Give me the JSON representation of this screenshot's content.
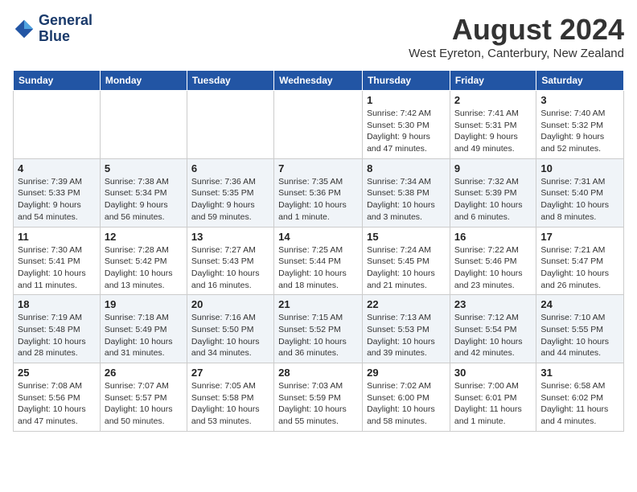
{
  "header": {
    "logo_line1": "General",
    "logo_line2": "Blue",
    "month_year": "August 2024",
    "location": "West Eyreton, Canterbury, New Zealand"
  },
  "days_of_week": [
    "Sunday",
    "Monday",
    "Tuesday",
    "Wednesday",
    "Thursday",
    "Friday",
    "Saturday"
  ],
  "weeks": [
    [
      {
        "day": "",
        "info": ""
      },
      {
        "day": "",
        "info": ""
      },
      {
        "day": "",
        "info": ""
      },
      {
        "day": "",
        "info": ""
      },
      {
        "day": "1",
        "info": "Sunrise: 7:42 AM\nSunset: 5:30 PM\nDaylight: 9 hours\nand 47 minutes."
      },
      {
        "day": "2",
        "info": "Sunrise: 7:41 AM\nSunset: 5:31 PM\nDaylight: 9 hours\nand 49 minutes."
      },
      {
        "day": "3",
        "info": "Sunrise: 7:40 AM\nSunset: 5:32 PM\nDaylight: 9 hours\nand 52 minutes."
      }
    ],
    [
      {
        "day": "4",
        "info": "Sunrise: 7:39 AM\nSunset: 5:33 PM\nDaylight: 9 hours\nand 54 minutes."
      },
      {
        "day": "5",
        "info": "Sunrise: 7:38 AM\nSunset: 5:34 PM\nDaylight: 9 hours\nand 56 minutes."
      },
      {
        "day": "6",
        "info": "Sunrise: 7:36 AM\nSunset: 5:35 PM\nDaylight: 9 hours\nand 59 minutes."
      },
      {
        "day": "7",
        "info": "Sunrise: 7:35 AM\nSunset: 5:36 PM\nDaylight: 10 hours\nand 1 minute."
      },
      {
        "day": "8",
        "info": "Sunrise: 7:34 AM\nSunset: 5:38 PM\nDaylight: 10 hours\nand 3 minutes."
      },
      {
        "day": "9",
        "info": "Sunrise: 7:32 AM\nSunset: 5:39 PM\nDaylight: 10 hours\nand 6 minutes."
      },
      {
        "day": "10",
        "info": "Sunrise: 7:31 AM\nSunset: 5:40 PM\nDaylight: 10 hours\nand 8 minutes."
      }
    ],
    [
      {
        "day": "11",
        "info": "Sunrise: 7:30 AM\nSunset: 5:41 PM\nDaylight: 10 hours\nand 11 minutes."
      },
      {
        "day": "12",
        "info": "Sunrise: 7:28 AM\nSunset: 5:42 PM\nDaylight: 10 hours\nand 13 minutes."
      },
      {
        "day": "13",
        "info": "Sunrise: 7:27 AM\nSunset: 5:43 PM\nDaylight: 10 hours\nand 16 minutes."
      },
      {
        "day": "14",
        "info": "Sunrise: 7:25 AM\nSunset: 5:44 PM\nDaylight: 10 hours\nand 18 minutes."
      },
      {
        "day": "15",
        "info": "Sunrise: 7:24 AM\nSunset: 5:45 PM\nDaylight: 10 hours\nand 21 minutes."
      },
      {
        "day": "16",
        "info": "Sunrise: 7:22 AM\nSunset: 5:46 PM\nDaylight: 10 hours\nand 23 minutes."
      },
      {
        "day": "17",
        "info": "Sunrise: 7:21 AM\nSunset: 5:47 PM\nDaylight: 10 hours\nand 26 minutes."
      }
    ],
    [
      {
        "day": "18",
        "info": "Sunrise: 7:19 AM\nSunset: 5:48 PM\nDaylight: 10 hours\nand 28 minutes."
      },
      {
        "day": "19",
        "info": "Sunrise: 7:18 AM\nSunset: 5:49 PM\nDaylight: 10 hours\nand 31 minutes."
      },
      {
        "day": "20",
        "info": "Sunrise: 7:16 AM\nSunset: 5:50 PM\nDaylight: 10 hours\nand 34 minutes."
      },
      {
        "day": "21",
        "info": "Sunrise: 7:15 AM\nSunset: 5:52 PM\nDaylight: 10 hours\nand 36 minutes."
      },
      {
        "day": "22",
        "info": "Sunrise: 7:13 AM\nSunset: 5:53 PM\nDaylight: 10 hours\nand 39 minutes."
      },
      {
        "day": "23",
        "info": "Sunrise: 7:12 AM\nSunset: 5:54 PM\nDaylight: 10 hours\nand 42 minutes."
      },
      {
        "day": "24",
        "info": "Sunrise: 7:10 AM\nSunset: 5:55 PM\nDaylight: 10 hours\nand 44 minutes."
      }
    ],
    [
      {
        "day": "25",
        "info": "Sunrise: 7:08 AM\nSunset: 5:56 PM\nDaylight: 10 hours\nand 47 minutes."
      },
      {
        "day": "26",
        "info": "Sunrise: 7:07 AM\nSunset: 5:57 PM\nDaylight: 10 hours\nand 50 minutes."
      },
      {
        "day": "27",
        "info": "Sunrise: 7:05 AM\nSunset: 5:58 PM\nDaylight: 10 hours\nand 53 minutes."
      },
      {
        "day": "28",
        "info": "Sunrise: 7:03 AM\nSunset: 5:59 PM\nDaylight: 10 hours\nand 55 minutes."
      },
      {
        "day": "29",
        "info": "Sunrise: 7:02 AM\nSunset: 6:00 PM\nDaylight: 10 hours\nand 58 minutes."
      },
      {
        "day": "30",
        "info": "Sunrise: 7:00 AM\nSunset: 6:01 PM\nDaylight: 11 hours\nand 1 minute."
      },
      {
        "day": "31",
        "info": "Sunrise: 6:58 AM\nSunset: 6:02 PM\nDaylight: 11 hours\nand 4 minutes."
      }
    ]
  ]
}
